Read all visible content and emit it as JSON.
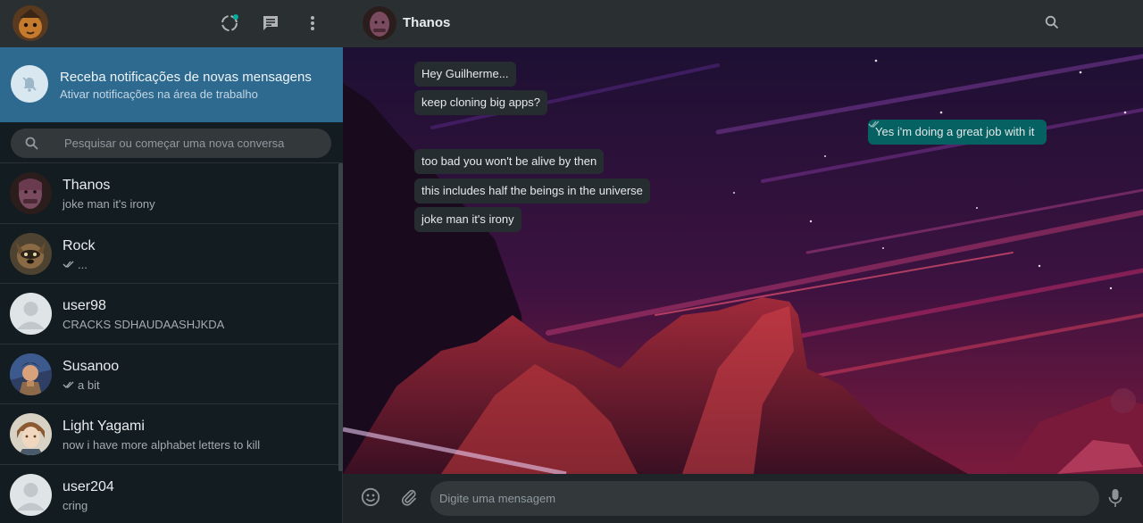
{
  "sidebar": {
    "notification": {
      "title": "Receba notificações de novas mensagens",
      "subtitle": "Ativar notificações na área de trabalho"
    },
    "search": {
      "placeholder": "Pesquisar ou começar uma nova conversa"
    },
    "chats": [
      {
        "name": "Thanos",
        "last": "joke man it's irony",
        "read": false
      },
      {
        "name": "Rock",
        "last": "...",
        "read": true
      },
      {
        "name": "user98",
        "last": "CRACKS SDHAUDAASHJKDA",
        "read": false
      },
      {
        "name": "Susanoo",
        "last": "a bit",
        "read": true
      },
      {
        "name": "Light Yagami",
        "last": "now i have more alphabet letters to kill",
        "read": false
      },
      {
        "name": "user204",
        "last": "cring",
        "read": false
      }
    ]
  },
  "conversation": {
    "contact_name": "Thanos",
    "messages": [
      {
        "text": "Hey Guilherme...",
        "dir": "in"
      },
      {
        "text": "keep cloning big apps?",
        "dir": "in"
      },
      {
        "text": "Yes i'm doing a great job with it",
        "dir": "out"
      },
      {
        "text": "too bad you won't be alive by then",
        "dir": "in"
      },
      {
        "text": "this includes half the beings in the universe",
        "dir": "in"
      },
      {
        "text": "joke man it's irony",
        "dir": "in"
      }
    ],
    "input_placeholder": "Digite uma mensagem"
  },
  "colors": {
    "panel": "#2a2f32",
    "background": "#131c21",
    "notification_bg": "#2e6a8f",
    "incoming_bubble": "#262d31",
    "outgoing_bubble": "#056162",
    "status_accent": "#00af9c"
  },
  "icons": [
    "status-icon",
    "new-chat-icon",
    "menu-icon",
    "bell-off-icon",
    "search-icon",
    "read-receipt-icon",
    "emoji-icon",
    "attach-icon",
    "mic-icon"
  ]
}
